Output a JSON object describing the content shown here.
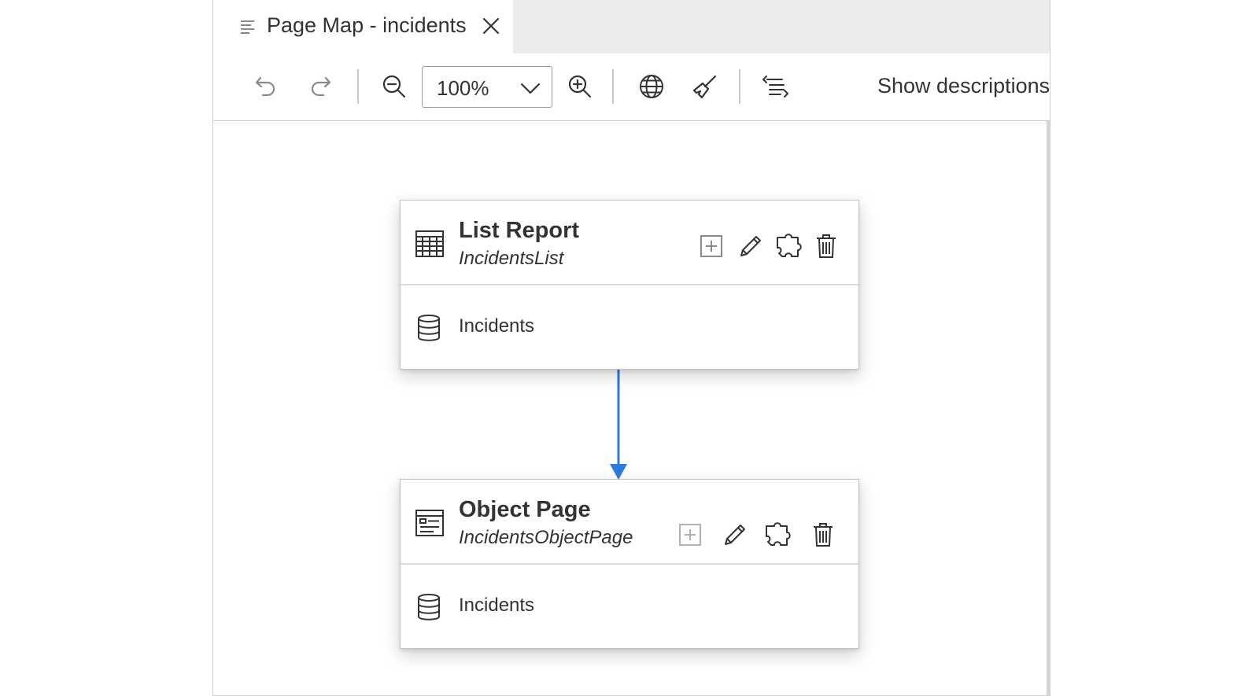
{
  "tab": {
    "title": "Page Map - incidents",
    "icon": "list-icon",
    "close_icon": "close-icon"
  },
  "toolbar": {
    "undo_icon": "undo-icon",
    "redo_icon": "redo-icon",
    "zoom_out_icon": "zoom-out-icon",
    "zoom_value": "100%",
    "zoom_in_icon": "zoom-in-icon",
    "globe_icon": "globe-icon",
    "clean_icon": "broom-icon",
    "layout_icon": "layout-icon",
    "show_descriptions_label": "Show descriptions"
  },
  "pages": [
    {
      "type": "List Report",
      "name": "IncidentsList",
      "entity": "Incidents",
      "icon": "table-icon",
      "add_enabled": true
    },
    {
      "type": "Object Page",
      "name": "IncidentsObjectPage",
      "entity": "Incidents",
      "icon": "form-icon",
      "add_enabled": false
    }
  ],
  "colors": {
    "connector": "#2b7be4",
    "tab_strip": "#ececec",
    "text": "#333333",
    "disabled_icon": "#9a9a9a"
  }
}
